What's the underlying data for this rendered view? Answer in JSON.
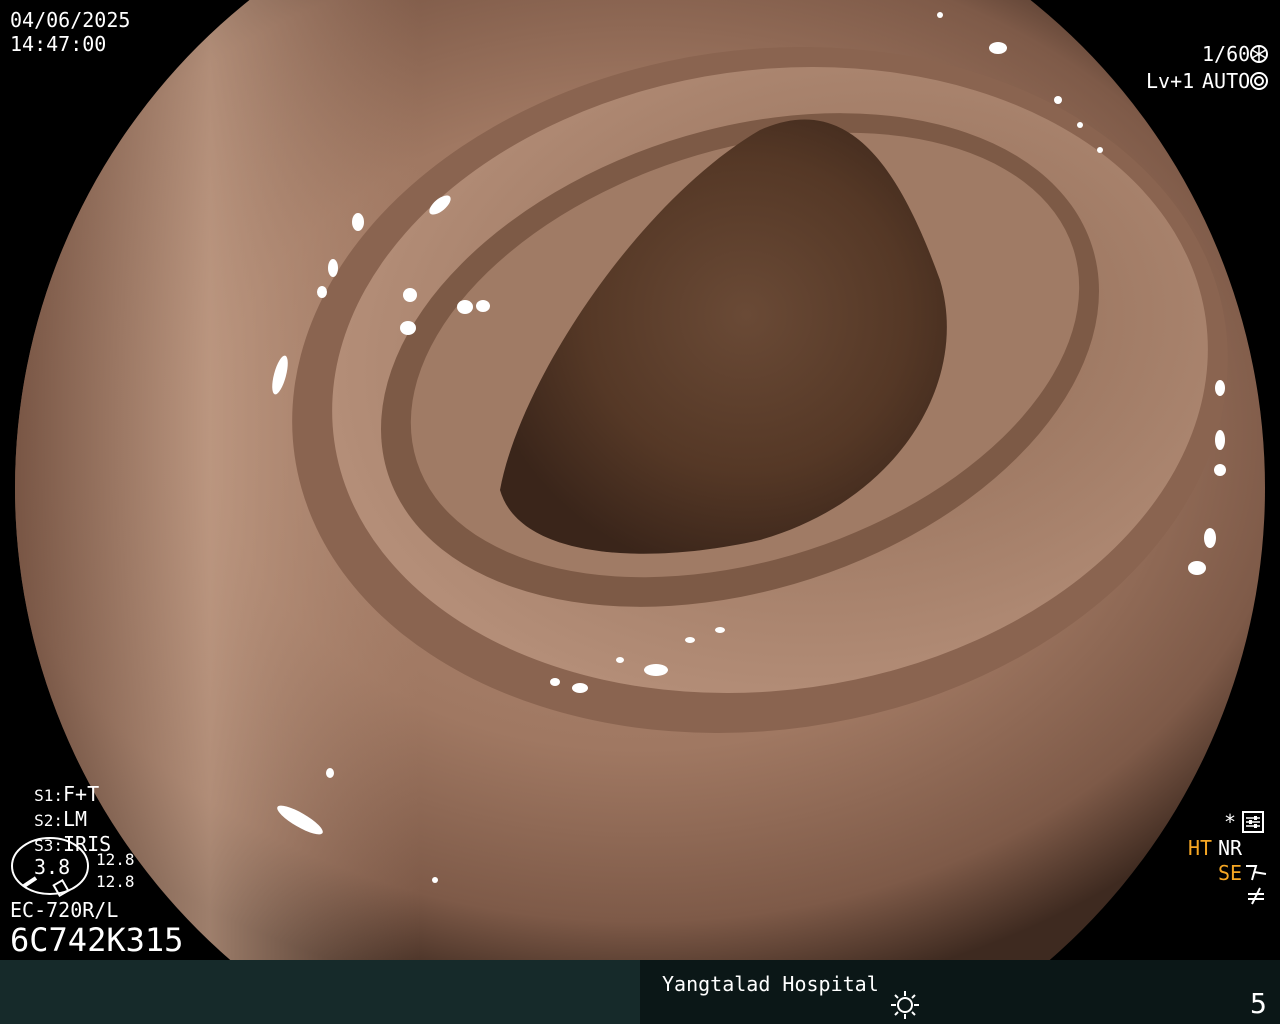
{
  "header": {
    "date": "04/06/2025",
    "time": "14:47:00"
  },
  "top_right": {
    "shutter": "1/60",
    "level": "Lv+1",
    "mode": "AUTO"
  },
  "left_settings": {
    "s1": {
      "key": "S1",
      "value": "F+T"
    },
    "s2": {
      "key": "S2",
      "value": "LM"
    },
    "s3": {
      "key": "S3",
      "value": "IRIS"
    },
    "gauge_value": "3.8",
    "side_value_1": "12.8",
    "side_value_2": "12.8",
    "scope_model": "EC-720R/L",
    "serial": "6C742K315"
  },
  "right_indicators": {
    "ht": "HT",
    "nr": "NR",
    "se": "SE"
  },
  "footer": {
    "hospital": "Yangtalad Hospital",
    "number": "5"
  },
  "colors": {
    "background": "#000000",
    "footer_left": "#162a2a",
    "footer_right": "#0b1717",
    "accent_orange": "#f5a623"
  }
}
